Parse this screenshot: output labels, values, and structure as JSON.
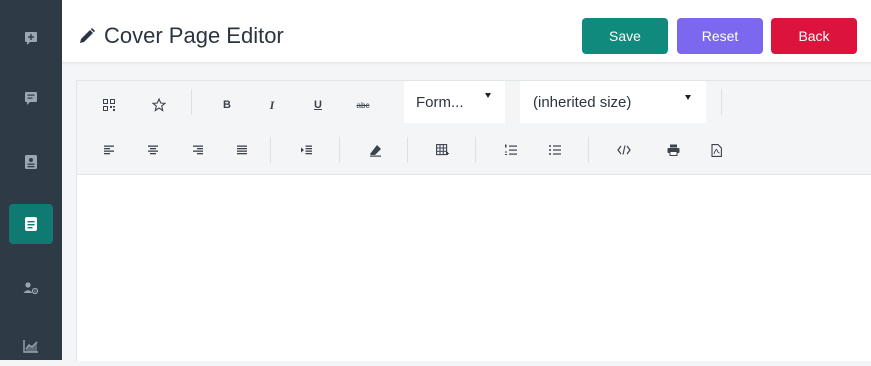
{
  "header": {
    "title": "Cover Page Editor",
    "save_label": "Save",
    "reset_label": "Reset",
    "back_label": "Back"
  },
  "toolbar": {
    "bold_label": "B",
    "italic_label": "I",
    "underline_label": "U",
    "strike_label": "abc",
    "format_value": "Form...",
    "size_value": "(inherited size)"
  },
  "colors": {
    "sidebar_bg": "#2e3b46",
    "sidebar_active": "#0f7a72",
    "save": "#0f8a7d",
    "reset": "#7b68ee",
    "back": "#dc143c"
  }
}
